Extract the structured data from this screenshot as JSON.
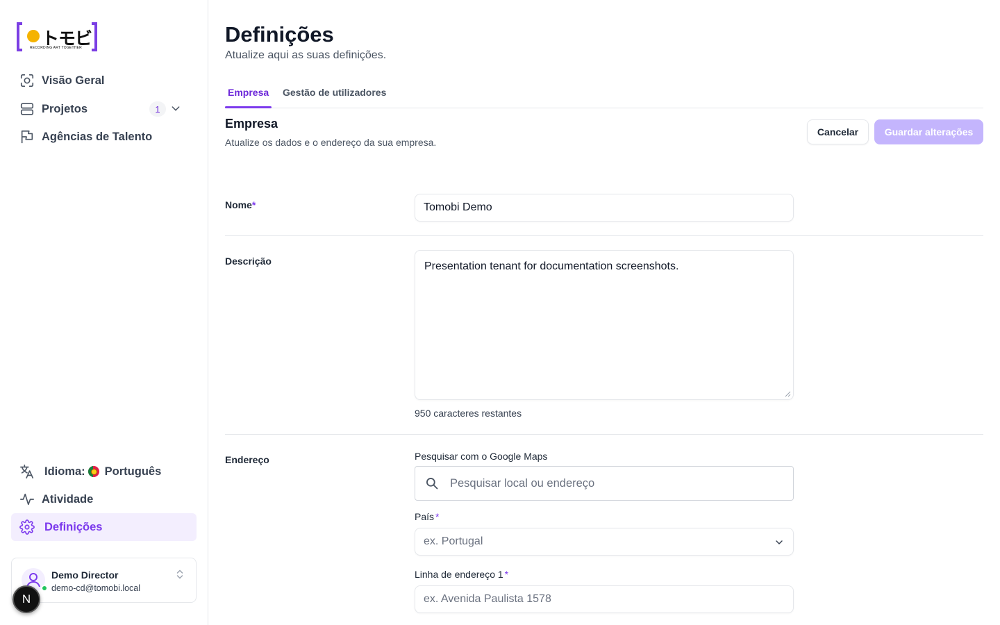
{
  "brand": {
    "logo_text": "トモビ",
    "tagline": "RECORDING ART TOGETHER",
    "colors": {
      "accent": "#7c3aed",
      "logo_frame": "#7b3fe4",
      "logo_dot": "#f5b301"
    }
  },
  "sidebar": {
    "top_items": [
      {
        "label": "Visão Geral",
        "icon": "overview-scan-icon"
      },
      {
        "label": "Projetos",
        "icon": "projects-stack-icon",
        "badge": "1"
      },
      {
        "label": "Agências de Talento",
        "icon": "flag-icon"
      }
    ],
    "language": {
      "prefix": "Idioma:",
      "value": "Português",
      "icon": "translate-icon"
    },
    "activity": {
      "label": "Atividade",
      "icon": "activity-pulse-icon"
    },
    "settings": {
      "label": "Definições",
      "icon": "gear-icon"
    },
    "user": {
      "name": "Demo Director",
      "email": "demo-cd@tomobi.local"
    },
    "dev_badge": "N"
  },
  "page": {
    "title": "Definições",
    "subtitle": "Atualize aqui as suas definições.",
    "tabs": [
      {
        "label": "Empresa"
      },
      {
        "label": "Gestão de utilizadores"
      }
    ]
  },
  "section": {
    "title": "Empresa",
    "subtitle": "Atualize os dados e o endereço da sua empresa.",
    "cancel_label": "Cancelar",
    "save_label": "Guardar alterações"
  },
  "form": {
    "name": {
      "label": "Nome",
      "required": "*",
      "value": "Tomobi Demo"
    },
    "description": {
      "label": "Descrição",
      "value": "Presentation tenant for documentation screenshots.",
      "counter": "950 caracteres restantes"
    },
    "address": {
      "label": "Endereço",
      "search_label": "Pesquisar com o Google Maps",
      "search_placeholder": "Pesquisar local ou endereço",
      "country_label": "País",
      "country_required": "*",
      "country_placeholder": "ex. Portugal",
      "line1_label": "Linha de endereço 1",
      "line1_required": "*",
      "line1_placeholder": "ex. Avenida Paulista 1578"
    }
  }
}
